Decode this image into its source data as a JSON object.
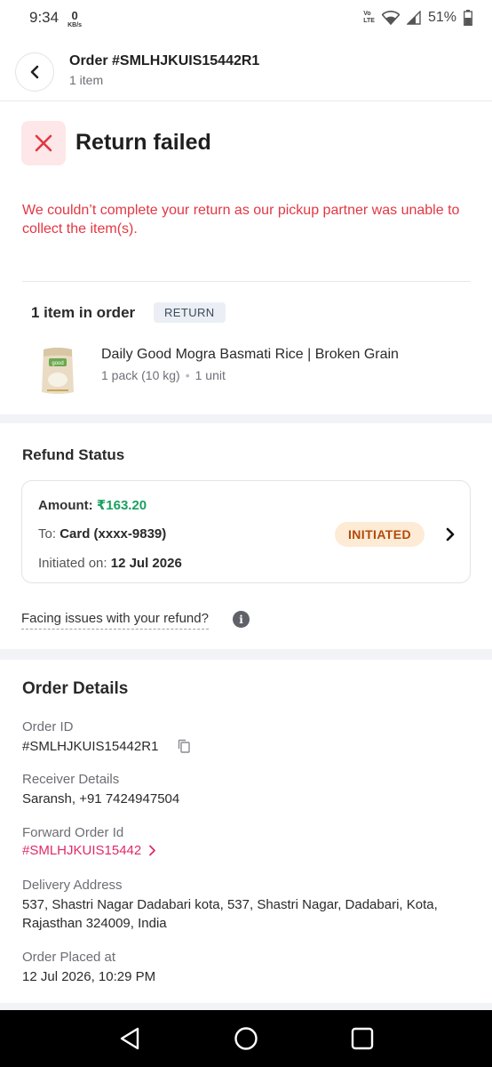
{
  "status_bar": {
    "time": "9:34",
    "net_speed": "0",
    "net_unit": "KB/s",
    "volte_top": "Vo",
    "volte_bottom": "LTE",
    "battery": "51%"
  },
  "header": {
    "title": "Order #SMLHJKUIS15442R1",
    "subtitle": "1 item"
  },
  "return_status": {
    "title": "Return failed",
    "message": "We couldn’t complete your return as our pickup partner was unable to collect the item(s)."
  },
  "items": {
    "heading": "1 item in order",
    "badge": "RETURN",
    "product": {
      "name": "Daily Good Mogra Basmati Rice | Broken Grain",
      "pack": "1 pack (10 kg)",
      "qty": "1 unit",
      "image_text": "good"
    }
  },
  "refund": {
    "title": "Refund Status",
    "amount_label": "Amount:",
    "amount_value": "₹163.20",
    "to_label": "To:",
    "to_value": "Card (xxxx-9839)",
    "initiated_label": "Initiated on:",
    "initiated_value": "12 Jul 2026",
    "status": "INITIATED",
    "help_text": "Facing issues with your refund?"
  },
  "order_details": {
    "title": "Order Details",
    "order_id_label": "Order ID",
    "order_id_value": "#SMLHJKUIS15442R1",
    "receiver_label": "Receiver Details",
    "receiver_value": "Saransh, +91 7424947504",
    "forward_label": "Forward Order Id",
    "forward_value": "#SMLHJKUIS15442",
    "address_label": "Delivery Address",
    "address_value": "537, Shastri Nagar Dadabari kota, 537, Shastri Nagar, Dadabari, Kota, Rajasthan 324009, India",
    "placed_label": "Order Placed at",
    "placed_value": "12 Jul 2026, 10:29 PM"
  },
  "colors": {
    "error_red": "#e23744",
    "refund_green": "#1aa061",
    "link_pink": "#e0296a",
    "pill_bg": "#fdebd5",
    "pill_text": "#b34a0a"
  },
  "icons": {
    "back": "chevron-left-icon",
    "failed": "close-icon",
    "info": "info-icon",
    "copy": "copy-icon",
    "forward": "chevron-right-icon"
  }
}
